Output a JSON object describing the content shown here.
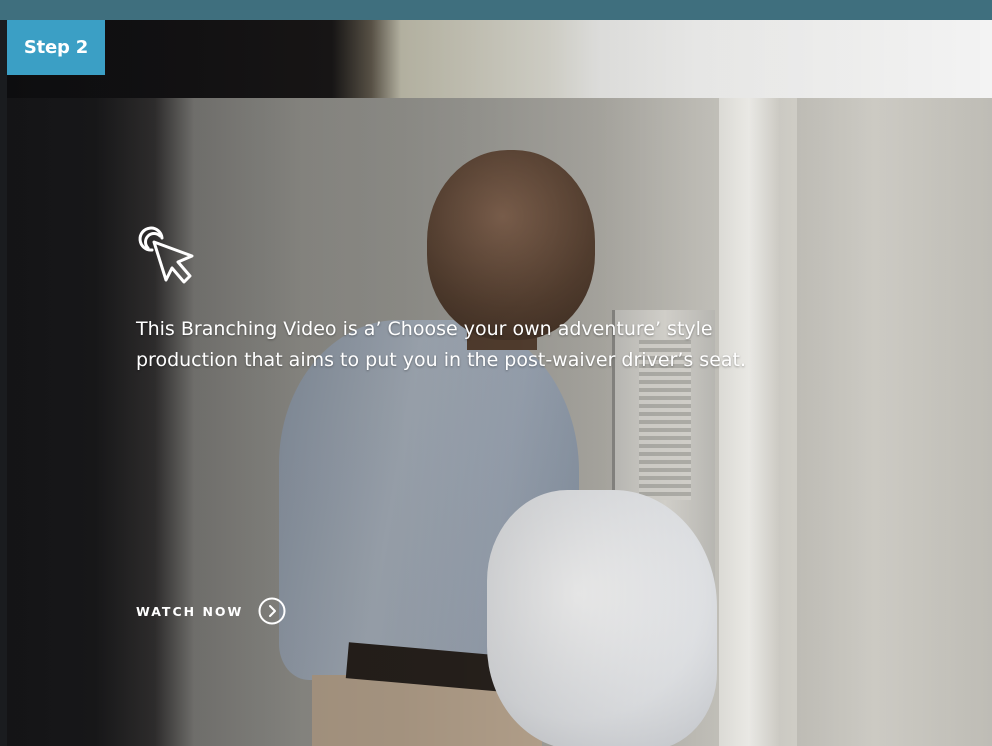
{
  "badge": {
    "step_label": "Step 2"
  },
  "hero": {
    "line1": "This Branching Video is a’ Choose your own adventure’ style",
    "line2": "production that aims to put you in the post-waiver driver’s seat.",
    "watch_label": "WATCH NOW",
    "icons": {
      "pointer": "click-pointer-icon",
      "watch": "chevron-right-circle-icon"
    }
  },
  "colors": {
    "accent": "#3b9fc5",
    "top_strip": "#3f6f7e",
    "text": "#ffffff"
  }
}
